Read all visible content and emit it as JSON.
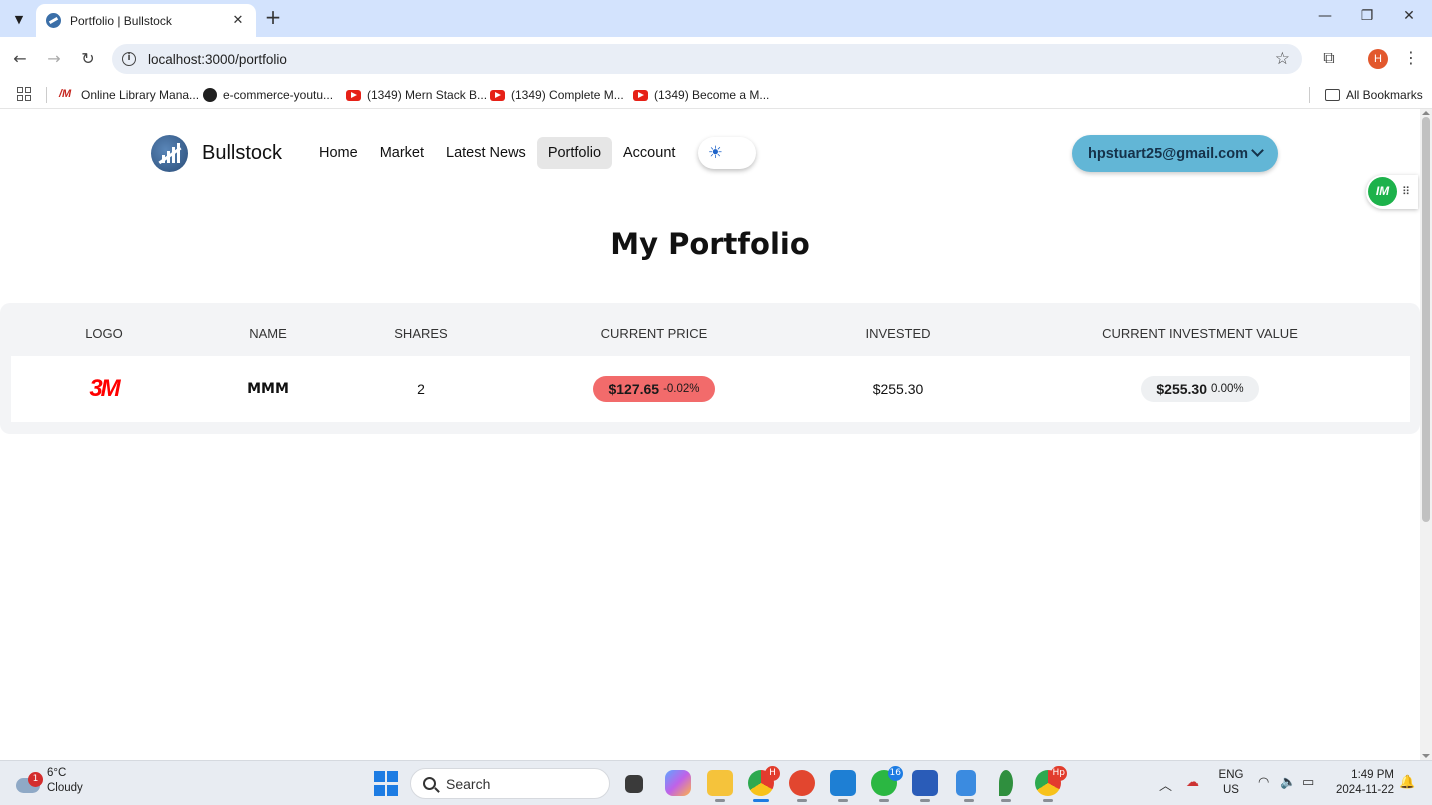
{
  "browser": {
    "tab_title": "Portfolio | Bullstock",
    "url": "localhost:3000/portfolio",
    "profile_initial": "H",
    "bookmarks": [
      {
        "label": "Online Library Mana...",
        "icon": "library-icon"
      },
      {
        "label": "e-commerce-youtu...",
        "icon": "github-icon"
      },
      {
        "label": "(1349) Mern Stack B...",
        "icon": "youtube-icon"
      },
      {
        "label": "(1349) Complete M...",
        "icon": "youtube-icon"
      },
      {
        "label": "(1349) Become a M...",
        "icon": "youtube-icon"
      }
    ],
    "all_bookmarks_label": "All Bookmarks"
  },
  "nav": {
    "brand": "Bullstock",
    "links": [
      "Home",
      "Market",
      "Latest News",
      "Portfolio",
      "Account"
    ],
    "active_link": "Portfolio",
    "user_email": "hpstuart25@gmail.com",
    "theme_icon": "sun-icon"
  },
  "extension": {
    "label": "IM"
  },
  "main": {
    "title": "My Portfolio",
    "table": {
      "headers": [
        "LOGO",
        "NAME",
        "SHARES",
        "CURRENT PRICE",
        "INVESTED",
        "CURRENT INVESTMENT VALUE"
      ],
      "rows": [
        {
          "logo": "3M",
          "name": "MMM",
          "shares": "2",
          "current_price": "$127.65",
          "price_change": "-0.02%",
          "invested": "$255.30",
          "current_value": "$255.30",
          "value_change": "0.00%"
        }
      ]
    }
  },
  "taskbar": {
    "weather_badge": "1",
    "temperature": "6°C",
    "condition": "Cloudy",
    "search_label": "Search",
    "chrome_badge": "H",
    "whatsapp_badge": "16",
    "chrome2_badge": "Hp",
    "lang_1": "ENG",
    "lang_2": "US",
    "time": "1:49 PM",
    "date": "2024-11-22"
  },
  "colors": {
    "accent_button": "#62b6d6",
    "price_down": "#f26b6b",
    "brand_3m": "#ff0000"
  }
}
